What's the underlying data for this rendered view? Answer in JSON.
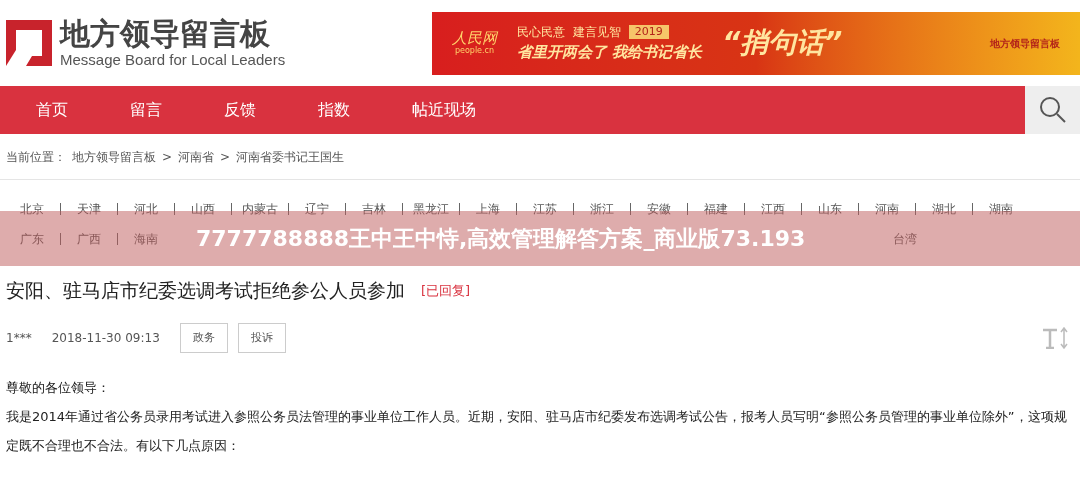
{
  "logo": {
    "title": "地方领导留言板",
    "subtitle": "Message Board for Local Leaders"
  },
  "ad_banner": {
    "brand": "人民网",
    "brand_url": "people.cn",
    "slogan": "民心民意  建言见智",
    "year": "2019",
    "headline": "省里开两会了 我给书记省长",
    "quote": "“捎句话”",
    "board_title": "地方领导留言板"
  },
  "nav": [
    {
      "label": "首页"
    },
    {
      "label": "留言"
    },
    {
      "label": "反馈"
    },
    {
      "label": "指数"
    },
    {
      "label": "帖近现场"
    }
  ],
  "breadcrumb": {
    "prefix": "当前位置：",
    "items": [
      "地方领导留言板",
      "河南省",
      "河南省委书记王国生"
    ],
    "separator": ">"
  },
  "provinces_row_1": [
    "北京",
    "天津",
    "河北",
    "山西",
    "内蒙古",
    "辽宁",
    "吉林",
    "黑龙江",
    "上海",
    "江苏",
    "浙江",
    "安徽",
    "福建",
    "江西",
    "山东",
    "河南",
    "湖北",
    "湖南"
  ],
  "provinces_row_2": [
    "广东",
    "广西",
    "海南",
    "台湾"
  ],
  "overlay_banner": "7777788888王中王中恃,高效管理解答方案_商业版73.193",
  "post": {
    "title": "安阳、驻马店市纪委选调考试拒绝参公人员参加",
    "status": "[已回复]",
    "author": "1***",
    "date": "2018-11-30 09:13",
    "tags": [
      "政务",
      "投诉"
    ],
    "body": [
      "尊敬的各位领导：",
      "我是2014年通过省公务员录用考试进入参照公务员法管理的事业单位工作人员。近期，安阳、驻马店市纪委发布选调考试公告，报考人员写明“参照公务员管理的事业单位除外”，这项规定既不合理也不合法。有以下几点原因："
    ]
  }
}
